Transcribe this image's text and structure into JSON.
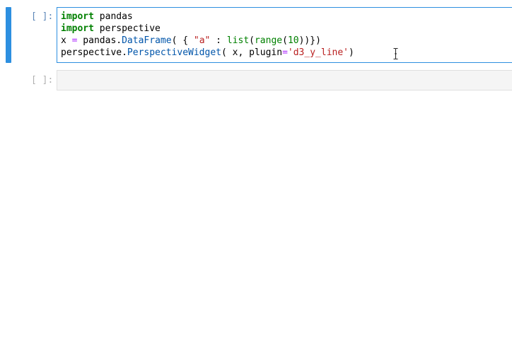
{
  "cells": [
    {
      "prompt": "[ ]:",
      "active": true,
      "lines": [
        [
          {
            "t": "import",
            "c": "kw"
          },
          {
            "t": " pandas",
            "c": ""
          }
        ],
        [
          {
            "t": "import",
            "c": "kw"
          },
          {
            "t": " perspective",
            "c": ""
          }
        ],
        [
          {
            "t": "x ",
            "c": ""
          },
          {
            "t": "=",
            "c": "op"
          },
          {
            "t": " pandas.",
            "c": ""
          },
          {
            "t": "DataFrame",
            "c": "fn"
          },
          {
            "t": "( { ",
            "c": ""
          },
          {
            "t": "\"a\"",
            "c": "str"
          },
          {
            "t": " : ",
            "c": ""
          },
          {
            "t": "list",
            "c": "bi"
          },
          {
            "t": "(",
            "c": ""
          },
          {
            "t": "range",
            "c": "bi"
          },
          {
            "t": "(",
            "c": ""
          },
          {
            "t": "10",
            "c": "num"
          },
          {
            "t": "))})",
            "c": ""
          }
        ],
        [
          {
            "t": "perspective.",
            "c": ""
          },
          {
            "t": "PerspectiveWidget",
            "c": "fn"
          },
          {
            "t": "( x, plugin",
            "c": ""
          },
          {
            "t": "=",
            "c": "op"
          },
          {
            "t": "'d3_y_line'",
            "c": "str"
          },
          {
            "t": ")",
            "c": ""
          }
        ]
      ]
    },
    {
      "prompt": "[ ]:",
      "active": false,
      "lines": []
    }
  ],
  "colors": {
    "active_border": "#2d8fe0",
    "keyword": "#008000",
    "operator": "#aa22ff",
    "string": "#ba2121",
    "function": "#0055aa"
  },
  "icons": {
    "cursor": "text-cursor-icon"
  }
}
